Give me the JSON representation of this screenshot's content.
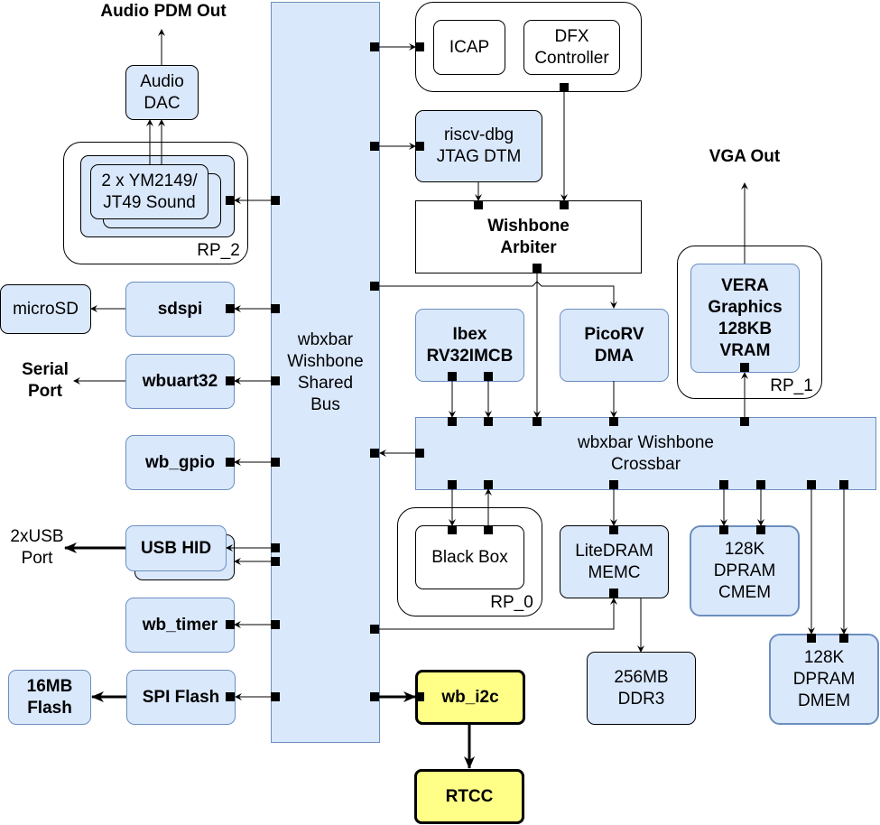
{
  "colors": {
    "block_fill": "#dae8fc",
    "block_stroke": "#6c8ebf",
    "highlight_fill": "#ffff88",
    "port": "#000000"
  },
  "labels": {
    "audio_out": "Audio PDM Out",
    "vga_out": "VGA Out",
    "serial_port": "Serial\nPort",
    "usb_port": "2xUSB\nPort",
    "rp2": "RP_2",
    "rp1": "RP_1",
    "rp0": "RP_0"
  },
  "nodes": {
    "bus": "wbxbar\nWishbone\nShared\nBus",
    "icap": "ICAP",
    "dfx": "DFX\nController",
    "riscv_dbg": "riscv-dbg\nJTAG DTM",
    "arbiter": "Wishbone\nArbiter",
    "audio_dac": "Audio\nDAC",
    "sound": "2 x YM2149/\nJT49 Sound",
    "microsd": "microSD",
    "sdspi": "sdspi",
    "wbuart32": "wbuart32",
    "wb_gpio": "wb_gpio",
    "usb_hid": "USB HID",
    "wb_timer": "wb_timer",
    "spi_flash": "SPI Flash",
    "flash16": "16MB\nFlash",
    "ibex": "Ibex\nRV32IMCB",
    "picorv": "PicoRV\nDMA",
    "vera": "VERA\nGraphics\n128KB\nVRAM",
    "crossbar": "wbxbar Wishbone\nCrossbar",
    "blackbox": "Black Box",
    "litedram": "LiteDRAM\nMEMC",
    "cmem": "128K\nDPRAM\nCMEM",
    "dmem": "128K\nDPRAM\nDMEM",
    "ddr3": "256MB\nDDR3",
    "wb_i2c": "wb_i2c",
    "rtcc": "RTCC"
  }
}
